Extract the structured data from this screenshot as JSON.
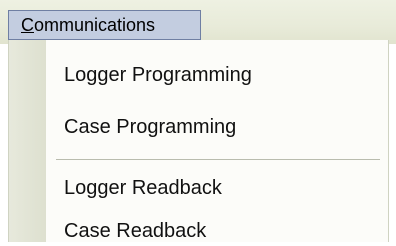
{
  "menubar": {
    "active_menu": {
      "accel_letter": "C",
      "rest": "ommunications"
    }
  },
  "dropdown": {
    "items": [
      {
        "label": "Logger Programming"
      },
      {
        "label": "Case Programming"
      },
      {
        "label": "Logger Readback"
      },
      {
        "label": "Case Readback"
      }
    ]
  }
}
